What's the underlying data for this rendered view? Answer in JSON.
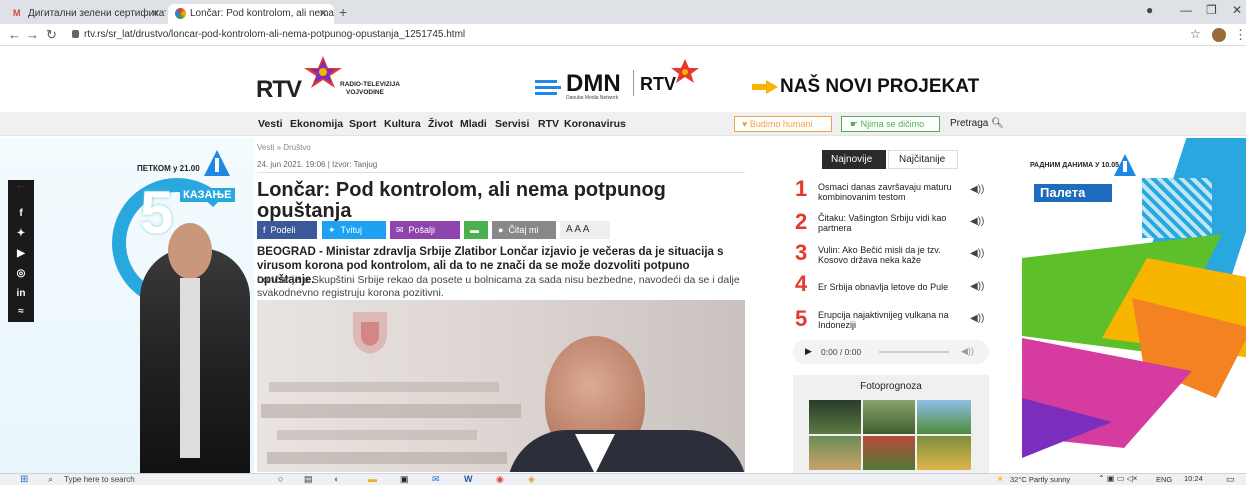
{
  "browser": {
    "tabs": [
      {
        "label": "Дигитални зелени сертификат",
        "active": false
      },
      {
        "label": "Lončar: Pod kontrolom, ali nema p",
        "active": true
      }
    ],
    "url": "rtv.rs/sr_lat/drustvo/loncar-pod-kontrolom-ali-nema-potpunog-opustanja_1251745.html"
  },
  "header": {
    "rtv_logo": "RTV",
    "rtv_subtitle1": "RADIO-TELEVIZIJA",
    "rtv_subtitle2": "VOJVODINE",
    "dmn_logo": "DMN",
    "dmn_sub": "Danube Media Network",
    "rtv_small": "RTV",
    "promo": "NAŠ NOVI PROJEKAT"
  },
  "nav": {
    "items": [
      "Vesti",
      "Ekonomija",
      "Sport",
      "Kultura",
      "Život",
      "Mladi",
      "Servisi",
      "RTV",
      "Koronavirus"
    ],
    "budimo_humani": "Budimo humani",
    "njima_se_dicimo": "Njima se dičimo",
    "pretraga": "Pretraga"
  },
  "left_banner": {
    "schedule": "ПЕТКОМ у 21.00",
    "number": "5",
    "word": "КАЗАЊЕ"
  },
  "article": {
    "breadcrumb": "Vesti » Društvo",
    "date": "24. jun 2021. 19:06 | Izvor: Tanjug",
    "title": "Lončar: Pod kontrolom, ali nema potpunog opuštanja",
    "share": {
      "podeli": "Podeli",
      "tvituj": "Tvituj",
      "posalji": "Pošalji",
      "citaj": "Čitaj mi",
      "font_sizes": "A A A"
    },
    "lead": "BEOGRAD - Ministar zdravlja Srbije Zlatibor Lončar izjavio je večeras da je situacija s virusom korona pod kontrolom, ali da to ne znači da se može dozvoliti potpuno opuštanje.",
    "body": "Lončar je u Skupštini Srbije rekao da posete u bolnicama za sada nisu bezbedne, navodeći da se i dalje svakodnevno registruju korona pozitivni."
  },
  "sidebar": {
    "tab_newest": "Najnovije",
    "tab_most_read": "Najčitanije",
    "items": [
      {
        "rank": "1",
        "text": "Osmaci danas završavaju maturu kombinovanim testom"
      },
      {
        "rank": "2",
        "text": "Čitaku: Vašington Srbiju vidi kao partnera"
      },
      {
        "rank": "3",
        "text": "Vulin: Ako Bečić misli da je tzv. Kosovo država neka kaže"
      },
      {
        "rank": "4",
        "text": "Er Srbija obnavlja letove do Pule"
      },
      {
        "rank": "5",
        "text": "Erupcija najaktivnijeg vulkana na Indoneziji"
      }
    ],
    "audio_time": "0:00 / 0:00",
    "fotoprognoza": "Fotoprognoza"
  },
  "right_banner": {
    "schedule": "РАДНИМ ДАНИМА У 10.05",
    "title": "Палета"
  },
  "taskbar": {
    "search_placeholder": "Type here to search",
    "weather": "32°C  Partly sunny",
    "lang": "ENG",
    "time": "10:24"
  },
  "colors": {
    "rtv_red": "#e6392b",
    "facebook": "#3b5998",
    "twitter": "#1da1f2",
    "posalji": "#8e44ad",
    "green": "#4caf50",
    "gray_btn": "#888888"
  }
}
